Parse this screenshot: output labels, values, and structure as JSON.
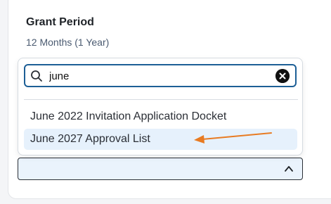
{
  "field": {
    "title": "Grant Period",
    "value": "12 Months (1 Year)"
  },
  "dropdown": {
    "search": {
      "value": "june",
      "placeholder": ""
    },
    "options": [
      {
        "label": "June 2022 Invitation Application Docket",
        "highlighted": false
      },
      {
        "label": "June 2027 Approval List",
        "highlighted": true
      }
    ]
  },
  "select": {
    "selected_value": ""
  },
  "colors": {
    "accent": "#1d5f96",
    "highlight": "#e6f1fc",
    "annotation": "#e87b22"
  },
  "icons": [
    "search-icon",
    "clear-icon",
    "chevron-up-icon",
    "annotation-arrow"
  ]
}
